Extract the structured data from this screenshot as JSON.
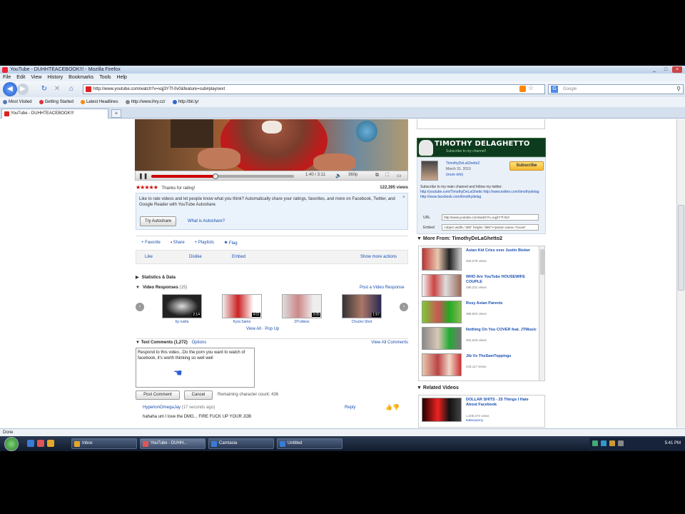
{
  "window": {
    "title": "YouTube - DUHHTEACEBOOK!!! - Mozilla Firefox",
    "controls": [
      "_",
      "□",
      "×"
    ]
  },
  "menu": [
    "File",
    "Edit",
    "View",
    "History",
    "Bookmarks",
    "Tools",
    "Help"
  ],
  "nav": {
    "url": "http://www.youtube.com/watch?v=xqj3Y7f-0v0&feature=sub#playnext",
    "search_placeholder": "Google"
  },
  "bookmarks": [
    "Most Visited",
    "Getting Started",
    "Latest Headlines",
    "http://www.ihry.cz/",
    "http://bit.ly/"
  ],
  "tabs": [
    {
      "label": "YouTube - DUHHTEACEBOOK!!!"
    }
  ],
  "video": {
    "time": "1:40 / 3:11",
    "quality": "360p",
    "progress_fraction": 0.45
  },
  "rating": {
    "stars": "★★★★★",
    "text": "Thanks for rating!",
    "views": "122,395 views"
  },
  "promo": {
    "text": "Like to rate videos and let people know what you think? Automatically share your ratings, favorites, and more on Facebook, Twitter, and Google Reader with YouTube Autoshare.",
    "button": "Try Autoshare",
    "link": "What is Autoshare?",
    "close": "×"
  },
  "actions": {
    "items": [
      {
        "icon": "favorite-icon",
        "label": "Favorite"
      },
      {
        "icon": "share-icon",
        "label": "Share"
      },
      {
        "icon": "playlists-icon",
        "label": "Playlists"
      },
      {
        "icon": "flag-icon",
        "label": "Flag"
      }
    ],
    "sub": [
      "Like",
      "Dislike",
      "Embed",
      "Show more actions"
    ]
  },
  "sections": {
    "stats": "Statistics & Data",
    "responses": "Video Responses",
    "responses_count": "(15)",
    "post_response": "Post a Video Response"
  },
  "responses": [
    {
      "label": "by ruvila",
      "duration": "2:14"
    },
    {
      "label": "Kyra Samo",
      "duration": "4:01"
    },
    {
      "label": "DTvideos",
      "duration": "3:05"
    },
    {
      "label": "Chucko Shot",
      "duration": "1:57"
    }
  ],
  "responses_pager": "View All · Pop Up",
  "comments": {
    "title": "Text Comments",
    "count": "(1,272)",
    "options": "Options",
    "view_all": "View All Comments",
    "draft": "Respond to this video...Do the porn you want to watch of facebook, it's worth thinking so well well",
    "post_button": "Post Comment",
    "cancel_button": "Cancel",
    "remaining": "Remaining character count: 436",
    "author": "HyperionOmegaJay",
    "ago": "(17 seconds ago)",
    "reply": "Reply",
    "text": "hahaha um I love the DMG... FIRE FUCK UP YOUR JOB"
  },
  "channel": {
    "banner_title": "TIMOTHY DELAGHETTO",
    "banner_sub": "Subscribe to my channel!",
    "uploader": "TimothyDeLaGhetto2",
    "date": "March 31, 2010",
    "more": "(more info)",
    "subscribe": "Subscribe",
    "description": "Subscribe to my main channel and follow my twitter:",
    "description_links": "http://youtube.com/TimothyDeLaGhetto  http://www.twitter.com/timothydelag  http://www.facebook.com/timothydelag",
    "url_label": "URL",
    "url_value": "http://www.youtube.com/watch?v=xqj3Y7f-0v0",
    "embed_label": "Embed",
    "embed_value": "<object width=\"480\" height=\"385\"><param name=\"movie\""
  },
  "more_from": {
    "title": "More From: TimothyDeLaGhetto2",
    "items": [
      {
        "title": "Asian Kid Cries over Justin Bieber",
        "views": "455,078 views"
      },
      {
        "title": "WHO Are YouTube HOUSEWIFE COUPLE",
        "views": "298,231 views"
      },
      {
        "title": "Rosy Asian Parents",
        "views": "388,902 views"
      },
      {
        "title": "Nothing On You COVER feat. JTMusic",
        "views": "302,540 views"
      },
      {
        "title": "Jib Vs TheSamToppings",
        "views": "243,117 views"
      }
    ]
  },
  "related": {
    "title": "Related Videos",
    "item": {
      "title": "DOLLAR SHITS - 25 Things I Hate About Facebook",
      "views": "1,208,372 views",
      "author": "kakseyarmy"
    }
  },
  "status": "Done",
  "taskbar": {
    "tasks": [
      "Inbox",
      "YouTube - DUHH...",
      "Camtasia",
      "Untitled"
    ],
    "clock": "5:41 PM"
  }
}
